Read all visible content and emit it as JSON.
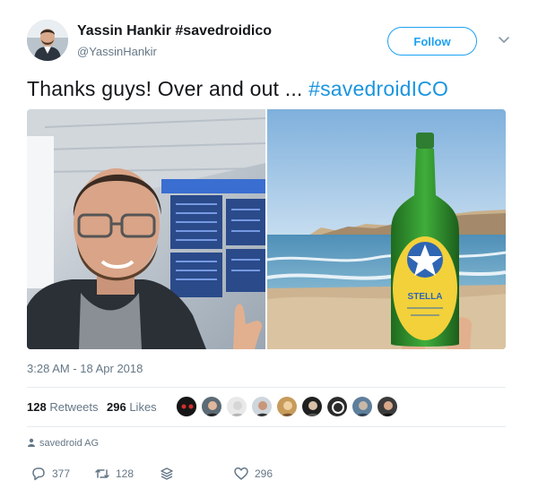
{
  "user": {
    "name": "Yassin Hankir #savedroidico",
    "handle": "@YassinHankir"
  },
  "header": {
    "follow_label": "Follow"
  },
  "tweet": {
    "text_prefix": "Thanks guys! Over and out ... ",
    "hashtag": "#savedroidICO",
    "timestamp": "3:28 AM - 18 Apr 2018",
    "source": "savedroid AG"
  },
  "media": {
    "beer_label": "STELLA"
  },
  "stats": {
    "retweets_count": "128",
    "retweets_label": "Retweets",
    "likes_count": "296",
    "likes_label": "Likes",
    "liker_count": 9
  },
  "actions": {
    "replies": "377",
    "retweets": "128",
    "likes": "296"
  },
  "colors": {
    "accent": "#1da1f2",
    "hashtag": "#1b95e0",
    "muted": "#657786"
  },
  "icons": [
    "chevron-down-icon",
    "person-icon",
    "reply-icon",
    "retweet-icon",
    "stack-icon",
    "heart-icon"
  ]
}
